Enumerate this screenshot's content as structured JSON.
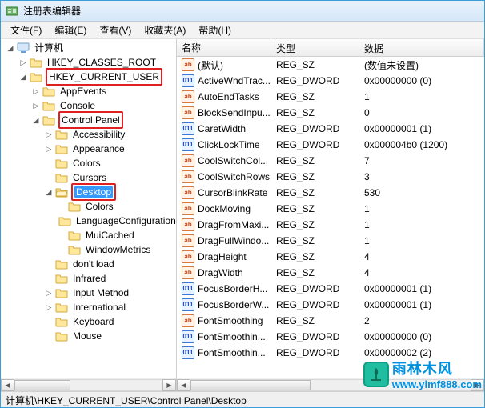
{
  "title": "注册表编辑器",
  "menu": [
    "文件(F)",
    "编辑(E)",
    "查看(V)",
    "收藏夹(A)",
    "帮助(H)"
  ],
  "tree": {
    "root": "计算机",
    "hkcr": "HKEY_CLASSES_ROOT",
    "hkcu": "HKEY_CURRENT_USER",
    "appevents": "AppEvents",
    "console": "Console",
    "controlpanel": "Control Panel",
    "accessibility": "Accessibility",
    "appearance": "Appearance",
    "colors": "Colors",
    "cursors": "Cursors",
    "desktop": "Desktop",
    "dcolors": "Colors",
    "langcfg": "LanguageConfiguration",
    "muicached": "MuiCached",
    "winmetrics": "WindowMetrics",
    "dontload": "don't load",
    "infrared": "Infrared",
    "inputmethod": "Input Method",
    "international": "International",
    "keyboard": "Keyboard",
    "mouse": "Mouse"
  },
  "columns": {
    "name": "名称",
    "type": "类型",
    "data": "数据"
  },
  "values": [
    {
      "icon": "sz",
      "name": "(默认)",
      "type": "REG_SZ",
      "data": "(数值未设置)"
    },
    {
      "icon": "dw",
      "name": "ActiveWndTrac...",
      "type": "REG_DWORD",
      "data": "0x00000000 (0)"
    },
    {
      "icon": "sz",
      "name": "AutoEndTasks",
      "type": "REG_SZ",
      "data": "1"
    },
    {
      "icon": "sz",
      "name": "BlockSendInpu...",
      "type": "REG_SZ",
      "data": "0"
    },
    {
      "icon": "dw",
      "name": "CaretWidth",
      "type": "REG_DWORD",
      "data": "0x00000001 (1)"
    },
    {
      "icon": "dw",
      "name": "ClickLockTime",
      "type": "REG_DWORD",
      "data": "0x000004b0 (1200)"
    },
    {
      "icon": "sz",
      "name": "CoolSwitchCol...",
      "type": "REG_SZ",
      "data": "7"
    },
    {
      "icon": "sz",
      "name": "CoolSwitchRows",
      "type": "REG_SZ",
      "data": "3"
    },
    {
      "icon": "sz",
      "name": "CursorBlinkRate",
      "type": "REG_SZ",
      "data": "530"
    },
    {
      "icon": "sz",
      "name": "DockMoving",
      "type": "REG_SZ",
      "data": "1"
    },
    {
      "icon": "sz",
      "name": "DragFromMaxi...",
      "type": "REG_SZ",
      "data": "1"
    },
    {
      "icon": "sz",
      "name": "DragFullWindo...",
      "type": "REG_SZ",
      "data": "1"
    },
    {
      "icon": "sz",
      "name": "DragHeight",
      "type": "REG_SZ",
      "data": "4"
    },
    {
      "icon": "sz",
      "name": "DragWidth",
      "type": "REG_SZ",
      "data": "4"
    },
    {
      "icon": "dw",
      "name": "FocusBorderH...",
      "type": "REG_DWORD",
      "data": "0x00000001 (1)"
    },
    {
      "icon": "dw",
      "name": "FocusBorderW...",
      "type": "REG_DWORD",
      "data": "0x00000001 (1)"
    },
    {
      "icon": "sz",
      "name": "FontSmoothing",
      "type": "REG_SZ",
      "data": "2"
    },
    {
      "icon": "dw",
      "name": "FontSmoothin...",
      "type": "REG_DWORD",
      "data": "0x00000000 (0)"
    },
    {
      "icon": "dw",
      "name": "FontSmoothin...",
      "type": "REG_DWORD",
      "data": "0x00000002 (2)"
    }
  ],
  "statusbar": "计算机\\HKEY_CURRENT_USER\\Control Panel\\Desktop",
  "watermark": {
    "cn": "雨林木风",
    "url": "www.ylmf888.com"
  }
}
